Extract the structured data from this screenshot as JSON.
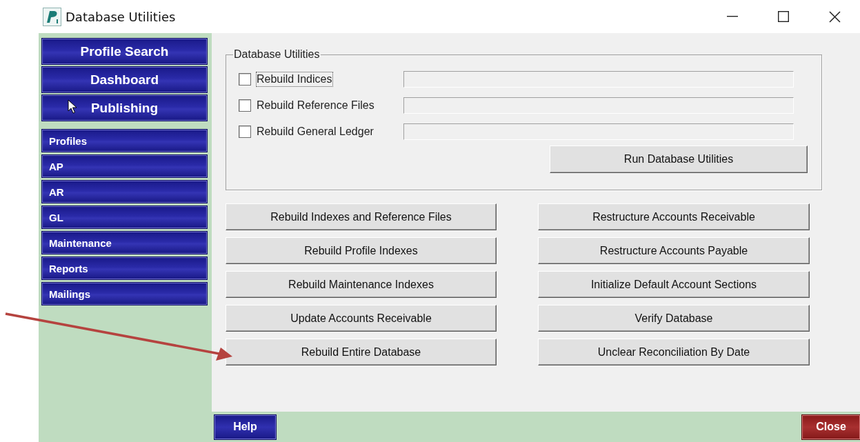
{
  "window": {
    "title": "Database Utilities"
  },
  "sidebar": {
    "primary": [
      {
        "label": "Profile Search"
      },
      {
        "label": "Dashboard"
      },
      {
        "label": "Publishing"
      }
    ],
    "modules": [
      {
        "label": "Profiles"
      },
      {
        "label": "AP"
      },
      {
        "label": "AR"
      },
      {
        "label": "GL"
      },
      {
        "label": "Maintenance"
      },
      {
        "label": "Reports"
      },
      {
        "label": "Mailings"
      }
    ]
  },
  "utilities_group": {
    "title": "Database Utilities",
    "options": [
      {
        "label": "Rebuild Indices",
        "checked": false,
        "focused": true
      },
      {
        "label": "Rebuild Reference Files",
        "checked": false,
        "focused": false
      },
      {
        "label": "Rebuild General Ledger",
        "checked": false,
        "focused": false
      }
    ],
    "run_button": "Run Database Utilities"
  },
  "actions": {
    "left": [
      "Rebuild Indexes and Reference Files",
      "Rebuild Profile Indexes",
      "Rebuild Maintenance Indexes",
      "Update Accounts Receivable",
      "Rebuild Entire Database"
    ],
    "right": [
      "Restructure Accounts Receivable",
      "Restructure Accounts Payable",
      "Initialize Default Account Sections",
      "Verify Database",
      "Unclear Reconciliation By Date"
    ]
  },
  "footer": {
    "help": "Help",
    "close": "Close"
  }
}
